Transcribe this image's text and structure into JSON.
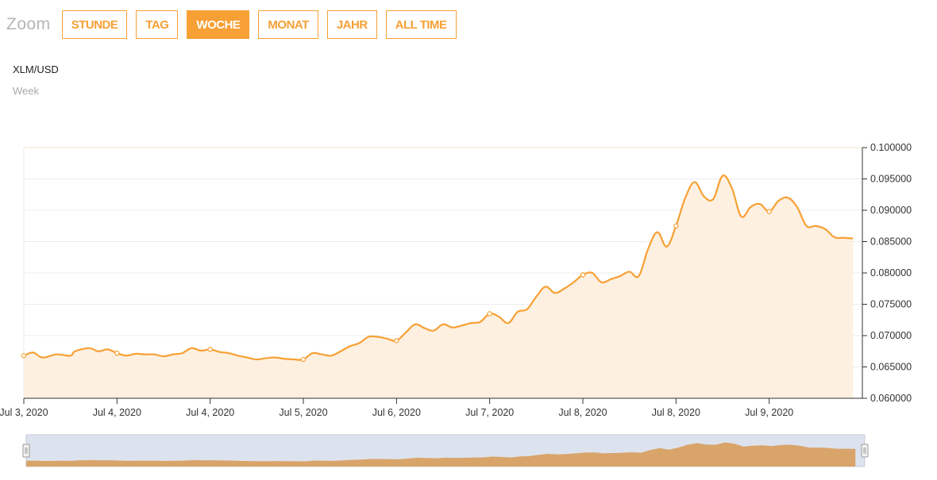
{
  "zoom": {
    "label": "Zoom",
    "buttons": [
      "STUNDE",
      "TAG",
      "WOCHE",
      "MONAT",
      "JAHR",
      "ALL TIME"
    ],
    "active": "WOCHE"
  },
  "pair": "XLM/USD",
  "period": "Week",
  "colors": {
    "accent": "#f7a035",
    "area": "#fdf0e0",
    "navigator_mask": "#dde3ee",
    "navigator_area": "#d9a46a"
  },
  "chart_data": {
    "type": "area",
    "ylim": [
      0.06,
      0.1
    ],
    "y_ticks": [
      "0.060000",
      "0.065000",
      "0.070000",
      "0.075000",
      "0.080000",
      "0.085000",
      "0.090000",
      "0.095000",
      "0.100000"
    ],
    "x_ticks": [
      "Jul 3, 2020",
      "Jul 4, 2020",
      "Jul 4, 2020",
      "Jul 5, 2020",
      "Jul 6, 2020",
      "Jul 7, 2020",
      "Jul 8, 2020",
      "Jul 8, 2020",
      "Jul 9, 2020"
    ],
    "x_range": [
      0,
      9.0
    ],
    "grid": true,
    "series": [
      {
        "x": [
          0,
          0.1,
          0.2,
          0.35,
          0.5,
          0.55,
          0.7,
          0.8,
          0.9,
          1.0,
          1.1,
          1.2,
          1.3,
          1.4,
          1.5,
          1.6,
          1.7,
          1.8,
          1.9,
          2.0,
          2.1,
          2.2,
          2.3,
          2.4,
          2.5,
          2.6,
          2.7,
          2.8,
          2.9,
          3.0,
          3.1,
          3.2,
          3.3,
          3.4,
          3.5,
          3.6,
          3.7,
          3.8,
          3.9,
          4.0,
          4.1,
          4.2,
          4.3,
          4.4,
          4.5,
          4.6,
          4.7,
          4.8,
          4.9,
          5.0,
          5.1,
          5.2,
          5.3,
          5.4,
          5.5,
          5.6,
          5.7,
          5.8,
          5.9,
          6.0,
          6.1,
          6.2,
          6.3,
          6.4,
          6.5,
          6.6,
          6.7,
          6.8,
          6.9,
          7.0,
          7.1,
          7.2,
          7.3,
          7.4,
          7.5,
          7.6,
          7.7,
          7.8,
          7.9,
          8.0,
          8.1,
          8.2,
          8.3,
          8.4,
          8.5,
          8.6,
          8.7,
          8.8,
          8.9
        ],
        "values": [
          0.0668,
          0.0673,
          0.0665,
          0.067,
          0.0668,
          0.0675,
          0.068,
          0.0675,
          0.0678,
          0.0672,
          0.0668,
          0.0671,
          0.067,
          0.067,
          0.0667,
          0.067,
          0.0672,
          0.068,
          0.0676,
          0.0678,
          0.0674,
          0.0672,
          0.0668,
          0.0665,
          0.0662,
          0.0664,
          0.0665,
          0.0663,
          0.0662,
          0.0662,
          0.0672,
          0.067,
          0.0668,
          0.0675,
          0.0683,
          0.0688,
          0.0698,
          0.0698,
          0.0695,
          0.0692,
          0.0705,
          0.0718,
          0.0712,
          0.0708,
          0.0718,
          0.0713,
          0.0716,
          0.072,
          0.0722,
          0.0735,
          0.073,
          0.072,
          0.0738,
          0.0742,
          0.0762,
          0.0778,
          0.0768,
          0.0775,
          0.0785,
          0.0797,
          0.08,
          0.0785,
          0.079,
          0.0795,
          0.0802,
          0.0795,
          0.0838,
          0.0865,
          0.0842,
          0.0875,
          0.092,
          0.0945,
          0.0922,
          0.0918,
          0.0955,
          0.0935,
          0.089,
          0.0905,
          0.091,
          0.0898,
          0.0915,
          0.092,
          0.0905,
          0.0875,
          0.0875,
          0.087,
          0.0857,
          0.0856,
          0.0855
        ],
        "markers_x": [
          0,
          1.0,
          2.0,
          3.0,
          4.0,
          5.0,
          6.0,
          7.0,
          8.0
        ]
      }
    ],
    "navigator": true
  }
}
